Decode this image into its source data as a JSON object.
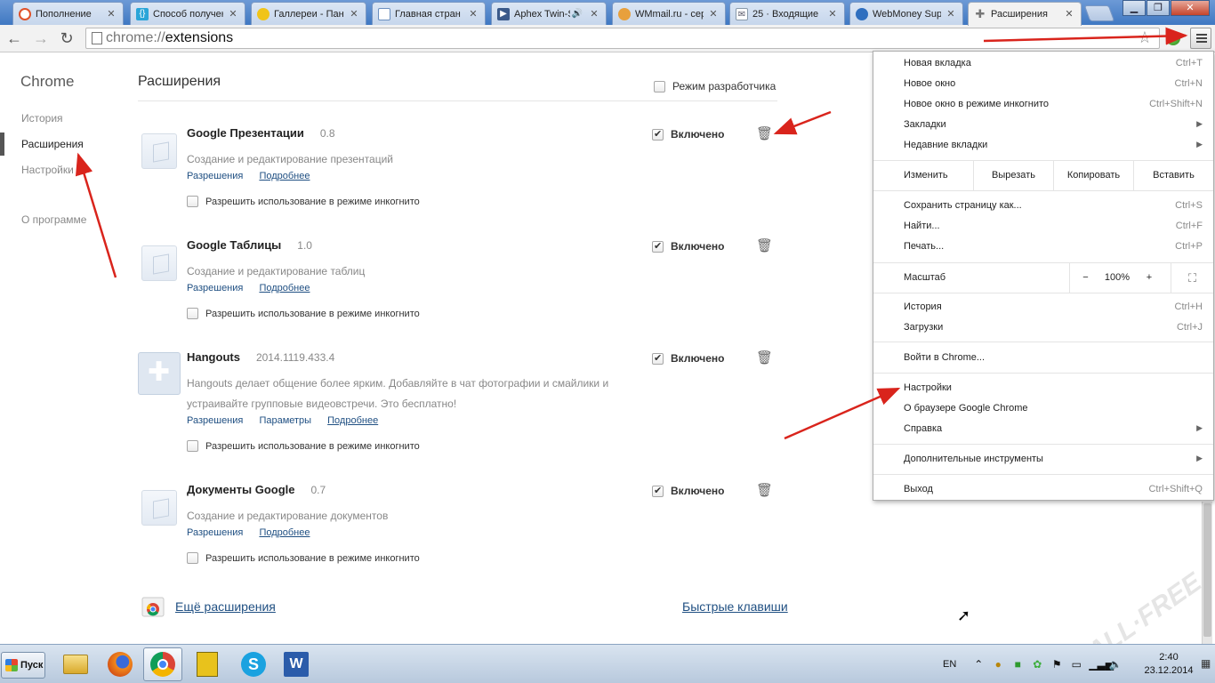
{
  "tabs": [
    {
      "title": "Пополнение",
      "icon": "opera-icon",
      "color": "#e0522a"
    },
    {
      "title": "Способ получен",
      "icon": "braces-icon",
      "color": "#2aa5d8"
    },
    {
      "title": "Галлереи - Пане",
      "icon": "bulb-icon",
      "color": "#f0c419"
    },
    {
      "title": "Главная стран",
      "icon": "page-icon",
      "color": "#6b8fbf"
    },
    {
      "title": "Aphex Twin-S",
      "icon": "play-icon",
      "color": "#3b5a8a"
    },
    {
      "title": "WMmail.ru - серв",
      "icon": "wmmail-icon",
      "color": "#e8a03c"
    },
    {
      "title": "25 · Входящие",
      "icon": "mail-icon",
      "color": "#8899aa"
    },
    {
      "title": "WebMoney Supp",
      "icon": "globe-icon",
      "color": "#2f6fbf"
    },
    {
      "title": "Расширения",
      "icon": "puzzle-icon",
      "color": "#8a8a8a",
      "active": true
    }
  ],
  "toolbar": {
    "url_scheme": "chrome://",
    "url_path": "extensions"
  },
  "sidebar": {
    "title": "Chrome",
    "items": [
      {
        "label": "История"
      },
      {
        "label": "Расширения",
        "selected": true
      },
      {
        "label": "Настройки"
      },
      {
        "label": "О программе"
      }
    ]
  },
  "main": {
    "title": "Расширения",
    "developer_mode_label": "Режим разработчика",
    "enabled_label": "Включено",
    "incognito_label": "Разрешить использование в режиме инкогнито",
    "extensions": [
      {
        "name": "Google Презентации",
        "version": "0.8",
        "desc": "Создание и редактирование презентаций",
        "links": [
          "Разрешения",
          "Подробнее"
        ]
      },
      {
        "name": "Google Таблицы",
        "version": "1.0",
        "desc": "Создание и редактирование таблиц",
        "links": [
          "Разрешения",
          "Подробнее"
        ]
      },
      {
        "name": "Hangouts",
        "version": "2014.1119.433.4",
        "desc": "Hangouts делает общение более ярким. Добавляйте в чат фотографии и смайлики и устраивайте групповые видеовстречи. Это бесплатно!",
        "links": [
          "Разрешения",
          "Параметры",
          "Подробнее"
        ]
      },
      {
        "name": "Документы Google",
        "version": "0.7",
        "desc": "Создание и редактирование документов",
        "links": [
          "Разрешения",
          "Подробнее"
        ]
      }
    ],
    "more_extensions": "Ещё расширения",
    "shortcuts": "Быстрые клавиши"
  },
  "menu": {
    "group1": [
      {
        "label": "Новая вкладка",
        "shortcut": "Ctrl+T"
      },
      {
        "label": "Новое окно",
        "shortcut": "Ctrl+N"
      },
      {
        "label": "Новое окно в режиме инкогнито",
        "shortcut": "Ctrl+Shift+N"
      },
      {
        "label": "Закладки",
        "submenu": true
      },
      {
        "label": "Недавние вкладки",
        "submenu": true
      }
    ],
    "edit": {
      "label": "Изменить",
      "cut": "Вырезать",
      "copy": "Копировать",
      "paste": "Вставить"
    },
    "group2": [
      {
        "label": "Сохранить страницу как...",
        "shortcut": "Ctrl+S"
      },
      {
        "label": "Найти...",
        "shortcut": "Ctrl+F"
      },
      {
        "label": "Печать...",
        "shortcut": "Ctrl+P"
      }
    ],
    "zoom": {
      "label": "Масштаб",
      "minus": "−",
      "value": "100%",
      "plus": "+"
    },
    "group3": [
      {
        "label": "История",
        "shortcut": "Ctrl+H"
      },
      {
        "label": "Загрузки",
        "shortcut": "Ctrl+J"
      }
    ],
    "signin": "Войти в Chrome...",
    "group4": [
      {
        "label": "Настройки"
      },
      {
        "label": "О браузере Google Chrome"
      },
      {
        "label": "Справка",
        "submenu": true
      }
    ],
    "more_tools": "Дополнительные инструменты",
    "exit": {
      "label": "Выход",
      "shortcut": "Ctrl+Shift+Q"
    }
  },
  "taskbar": {
    "start_label": "Пуск",
    "lang": "EN",
    "time": "2:40",
    "date": "23.12.2014"
  },
  "colors": {
    "link": "#1f4f82",
    "annotation_arrow": "#d9241c",
    "tab_strip": "#4a82c8"
  }
}
